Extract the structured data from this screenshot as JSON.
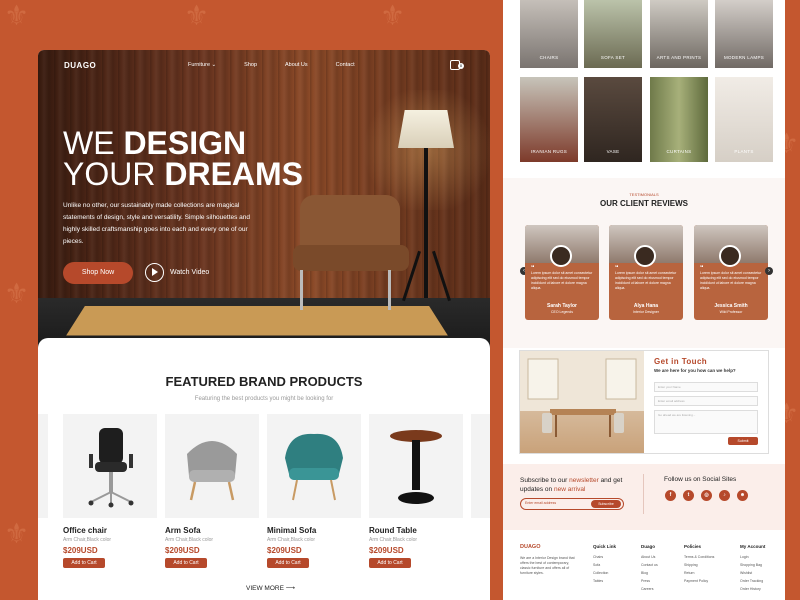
{
  "hero": {
    "logo": "DUAGO",
    "nav": [
      "Furniture ⌄",
      "Shop",
      "About Us",
      "Contact"
    ],
    "cart_count": "0",
    "title_line1_thin": "WE ",
    "title_line1_bold": "DESIGN",
    "title_line2_thin": "YOUR ",
    "title_line2_bold": "DREAMS",
    "description": "Unlike no other, our sustainably made collections are magical statements of design, style and versatility. Simple silhouettes and highly skilled craftsmanship goes into each and every one of our pieces.",
    "shop_now": "Shop Now",
    "watch_video": "Watch Video"
  },
  "featured": {
    "title": "FEATURED BRAND PRODUCTS",
    "subtitle": "Featuring the best products you might be looking for",
    "products": [
      {
        "name": "Office chair",
        "desc": "Arm Chair,Black color",
        "price": "$209USD",
        "button": "Add to Cart"
      },
      {
        "name": "Arm Sofa",
        "desc": "Arm Chair,Black color",
        "price": "$209USD",
        "button": "Add to Cart"
      },
      {
        "name": "Minimal Sofa",
        "desc": "Arm Chair,Black color",
        "price": "$209USD",
        "button": "Add to Cart"
      },
      {
        "name": "Round Table",
        "desc": "Arm Chair,Black color",
        "price": "$209USD",
        "button": "Add to Cart"
      }
    ],
    "view_more": "VIEW MORE ⟶"
  },
  "categories": [
    "CHAIRS",
    "SOFA SET",
    "ARTS AND PRINTS",
    "MODERN LAMPS",
    "IRANIAN RUGS",
    "VASE",
    "CURTAINS",
    "PLANTS"
  ],
  "reviews": {
    "kicker": "TESTIMONIALS",
    "title": "OUR CLIENT REVIEWS",
    "items": [
      {
        "text": "Lorem ipsum dolor sit amet consectetur adipiscing elit sed do eiusmod tempor incididunt ut labore et dolore magna aliqua.",
        "name": "Sarah Taylor",
        "role": "CEO Legends"
      },
      {
        "text": "Lorem ipsum dolor sit amet consectetur adipiscing elit sed do eiusmod tempor incididunt ut labore et dolore magna aliqua.",
        "name": "Alya Hana",
        "role": "Interior Designer"
      },
      {
        "text": "Lorem ipsum dolor sit amet consectetur adipiscing elit sed do eiusmod tempor incididunt ut labore et dolore magna aliqua.",
        "name": "Jessica Smith",
        "role": "Wild Professor"
      }
    ]
  },
  "contact": {
    "title": "Get in Touch",
    "subtitle": "We are here for you how can we help?",
    "name_placeholder": "Enter your Name",
    "email_placeholder": "Enter email address",
    "message_placeholder": "Go ahead we are listening...",
    "submit": "Submit"
  },
  "subscribe": {
    "text_a": "Subscribe to our ",
    "text_hl1": "newsletter",
    "text_b": " and get updates on ",
    "text_hl2": "new arrival",
    "placeholder": "Enter email address",
    "button": "Subscribe",
    "social_title": "Follow us on Social Sites",
    "socials": [
      "f",
      "t",
      "◎",
      "♪",
      "☻"
    ]
  },
  "footer": {
    "logo": "DUAGO",
    "about": "We are a Interior Design brand that offers the best of contemporary, classic furniture and offers all of furniture styles.",
    "columns": [
      {
        "head": "Quick Link",
        "links": [
          "Chairs",
          "Sofa",
          "Collection",
          "Tables"
        ]
      },
      {
        "head": "Duago",
        "links": [
          "About Us",
          "Contact us",
          "Blog",
          "Press",
          "Careers"
        ]
      },
      {
        "head": "Policies",
        "links": [
          "Terms & Conditions",
          "Shipping",
          "Return",
          "Payment Policy"
        ]
      },
      {
        "head": "My Account",
        "links": [
          "Login",
          "Shopping Bag",
          "Wishlist",
          "Order Tracking",
          "Order History"
        ]
      }
    ]
  },
  "colors": {
    "accent": "#b6492b",
    "background": "#c4572f"
  }
}
